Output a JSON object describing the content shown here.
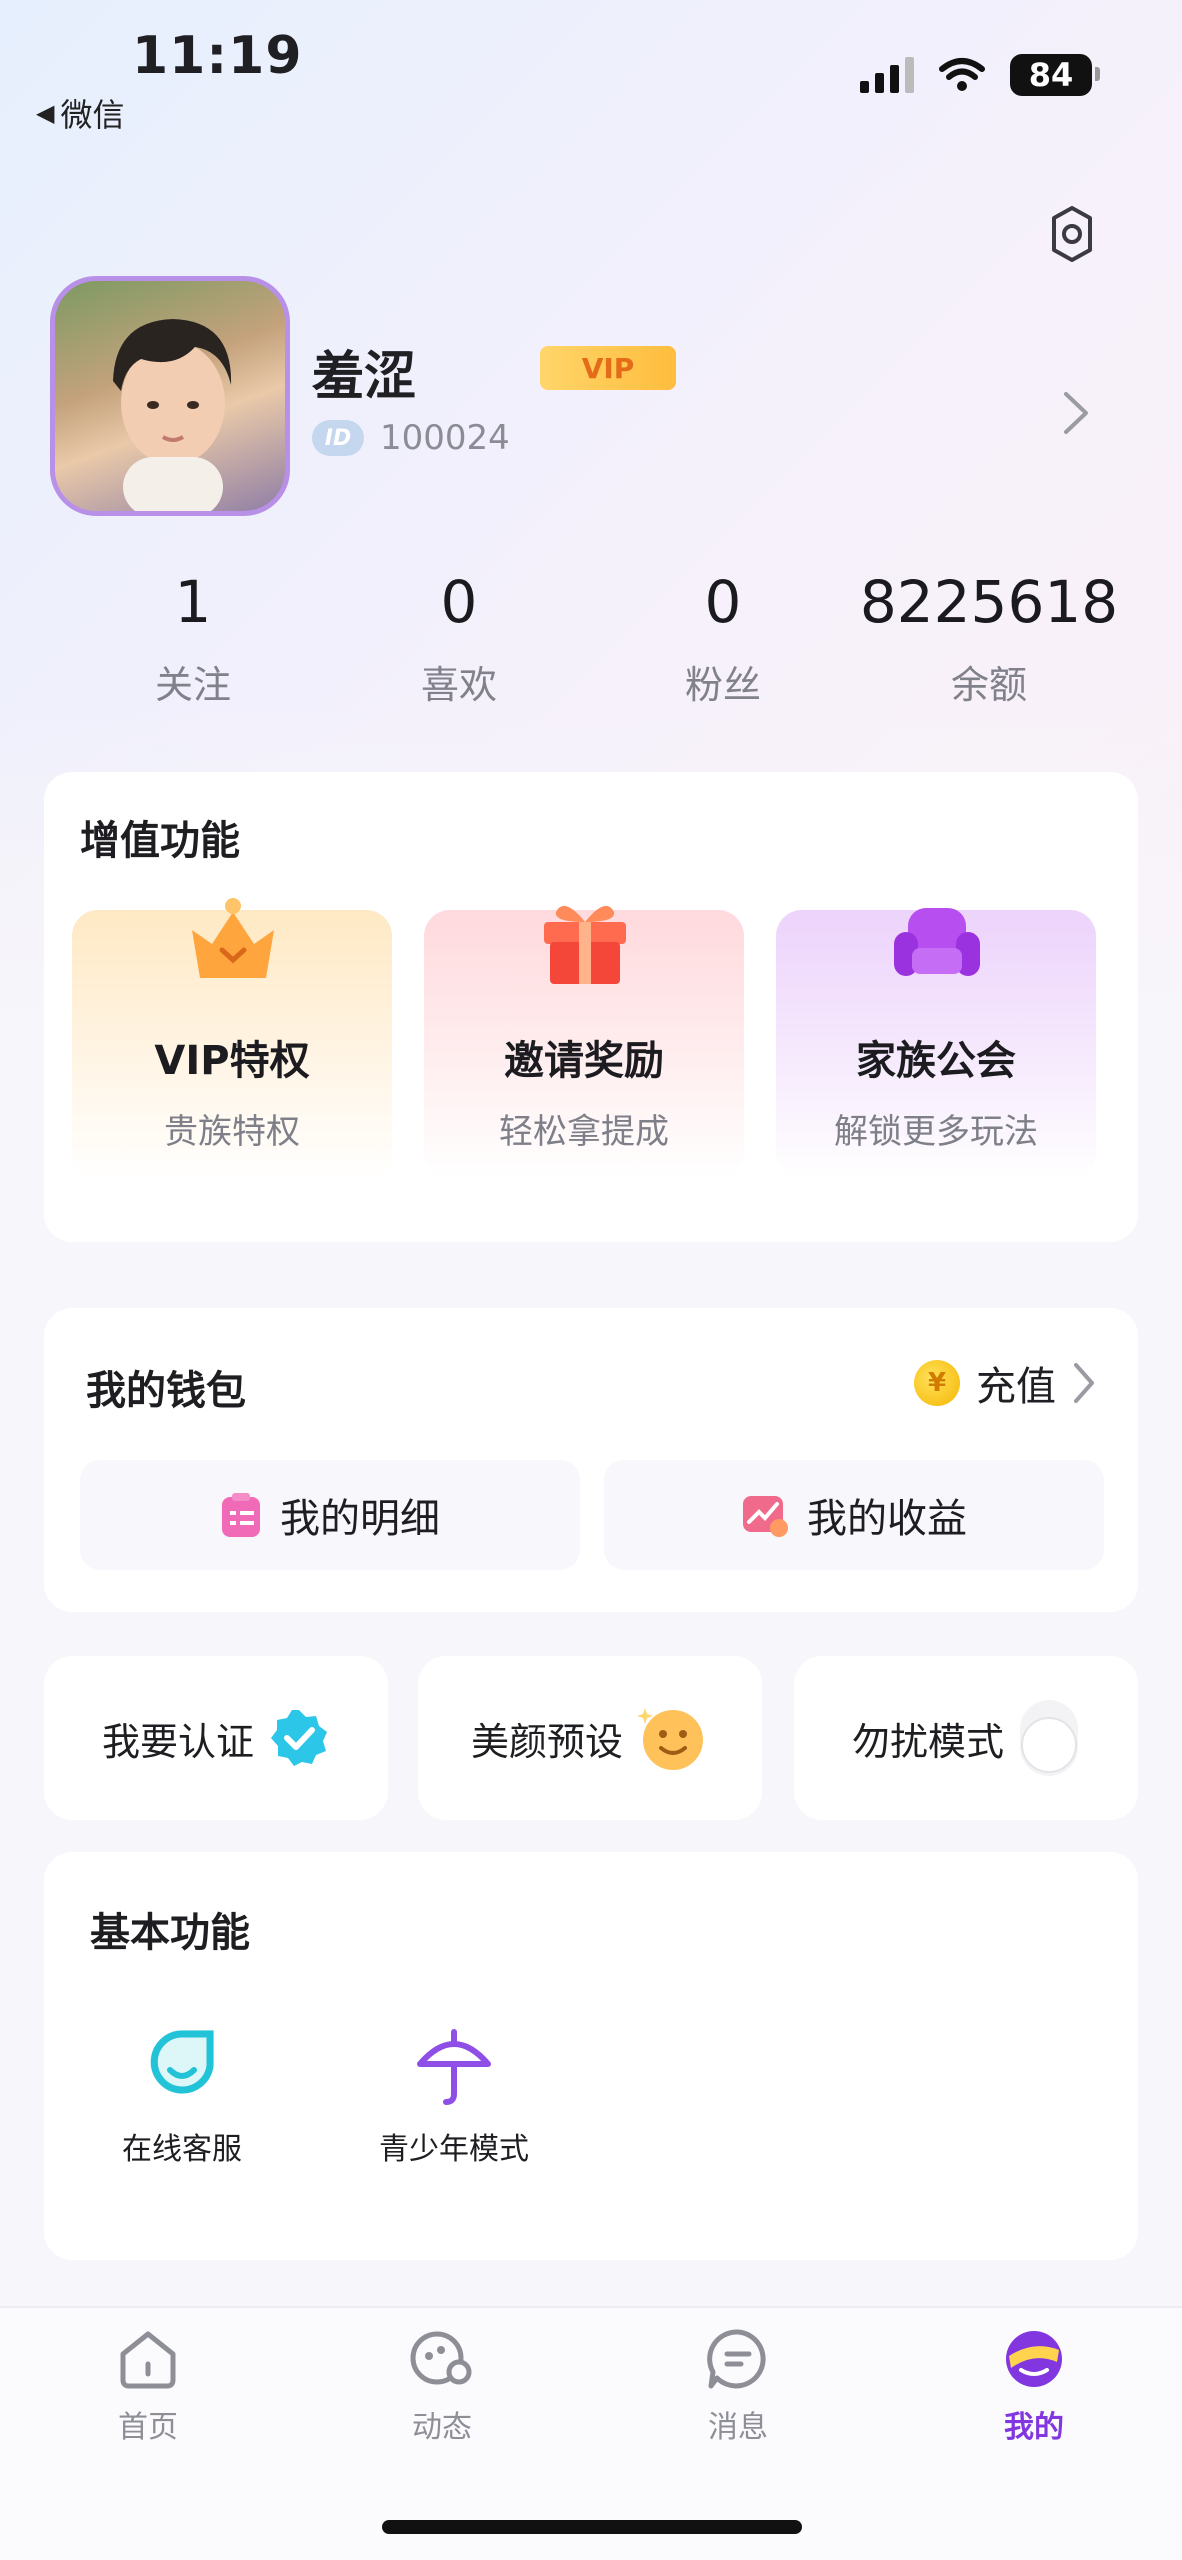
{
  "status_bar": {
    "time": "11:19",
    "back_app": "微信",
    "battery": "84"
  },
  "profile": {
    "nickname": "羞涩",
    "vip_badge": "VIP",
    "id_label": "ID",
    "id_value": "100024"
  },
  "stats": [
    {
      "value": "1",
      "label": "关注"
    },
    {
      "value": "0",
      "label": "喜欢"
    },
    {
      "value": "0",
      "label": "粉丝"
    },
    {
      "value": "8225618",
      "label": "余额"
    }
  ],
  "value_added": {
    "title": "增值功能",
    "items": [
      {
        "title": "VIP特权",
        "subtitle": "贵族特权",
        "icon": "crown-icon"
      },
      {
        "title": "邀请奖励",
        "subtitle": "轻松拿提成",
        "icon": "gift-icon"
      },
      {
        "title": "家族公会",
        "subtitle": "解锁更多玩法",
        "icon": "sofa-icon"
      }
    ]
  },
  "wallet": {
    "title": "我的钱包",
    "recharge_label": "充值",
    "coin_symbol": "¥",
    "details_label": "我的明细",
    "earnings_label": "我的收益"
  },
  "quick_actions": [
    {
      "label": "我要认证",
      "icon": "verified-badge-icon"
    },
    {
      "label": "美颜预设",
      "icon": "smiley-icon"
    },
    {
      "label": "勿扰模式",
      "icon": "toggle-icon",
      "on": false
    }
  ],
  "basic": {
    "title": "基本功能",
    "items": [
      {
        "label": "在线客服",
        "icon": "customer-service-icon"
      },
      {
        "label": "青少年模式",
        "icon": "umbrella-icon"
      }
    ]
  },
  "tabs": [
    {
      "label": "首页",
      "icon": "home-icon",
      "active": false
    },
    {
      "label": "动态",
      "icon": "moments-icon",
      "active": false
    },
    {
      "label": "消息",
      "icon": "message-icon",
      "active": false
    },
    {
      "label": "我的",
      "icon": "me-icon",
      "active": true
    }
  ],
  "colors": {
    "accent": "#8236e0",
    "vip_gold": "#ffbd3d",
    "verify_cyan": "#2cc6e8"
  }
}
